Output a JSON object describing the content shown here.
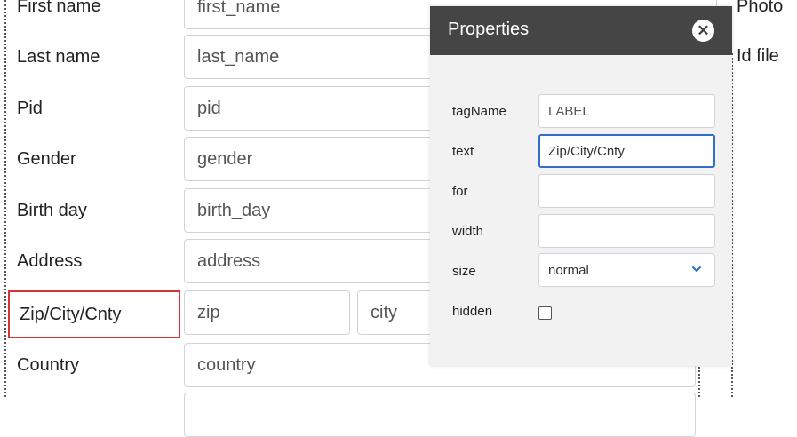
{
  "form": {
    "rows": [
      {
        "label": "First name",
        "placeholder": "first_name"
      },
      {
        "label": "Last name",
        "placeholder": "last_name"
      },
      {
        "label": "Pid",
        "placeholder": "pid"
      },
      {
        "label": "Gender",
        "placeholder": "gender"
      },
      {
        "label": "Birth day",
        "placeholder": "birth_day"
      },
      {
        "label": "Address",
        "placeholder": "address"
      },
      {
        "label": "Zip/City/Cnty",
        "placeholders": [
          "zip",
          "city"
        ]
      },
      {
        "label": "Country",
        "placeholder": "country"
      }
    ]
  },
  "side": {
    "photo_label": "Photo",
    "id_file_label": "Id file"
  },
  "properties": {
    "title": "Properties",
    "close_icon": "close-icon",
    "fields": {
      "tagName": {
        "label": "tagName",
        "value": "LABEL"
      },
      "text": {
        "label": "text",
        "value": "Zip/City/Cnty"
      },
      "for": {
        "label": "for",
        "value": ""
      },
      "width": {
        "label": "width",
        "value": ""
      },
      "size": {
        "label": "size",
        "value": "normal"
      },
      "hidden": {
        "label": "hidden",
        "checked": false
      }
    }
  },
  "colors": {
    "selection": "#d93434",
    "panel_header": "#454545",
    "focus": "#2f6fc7"
  }
}
